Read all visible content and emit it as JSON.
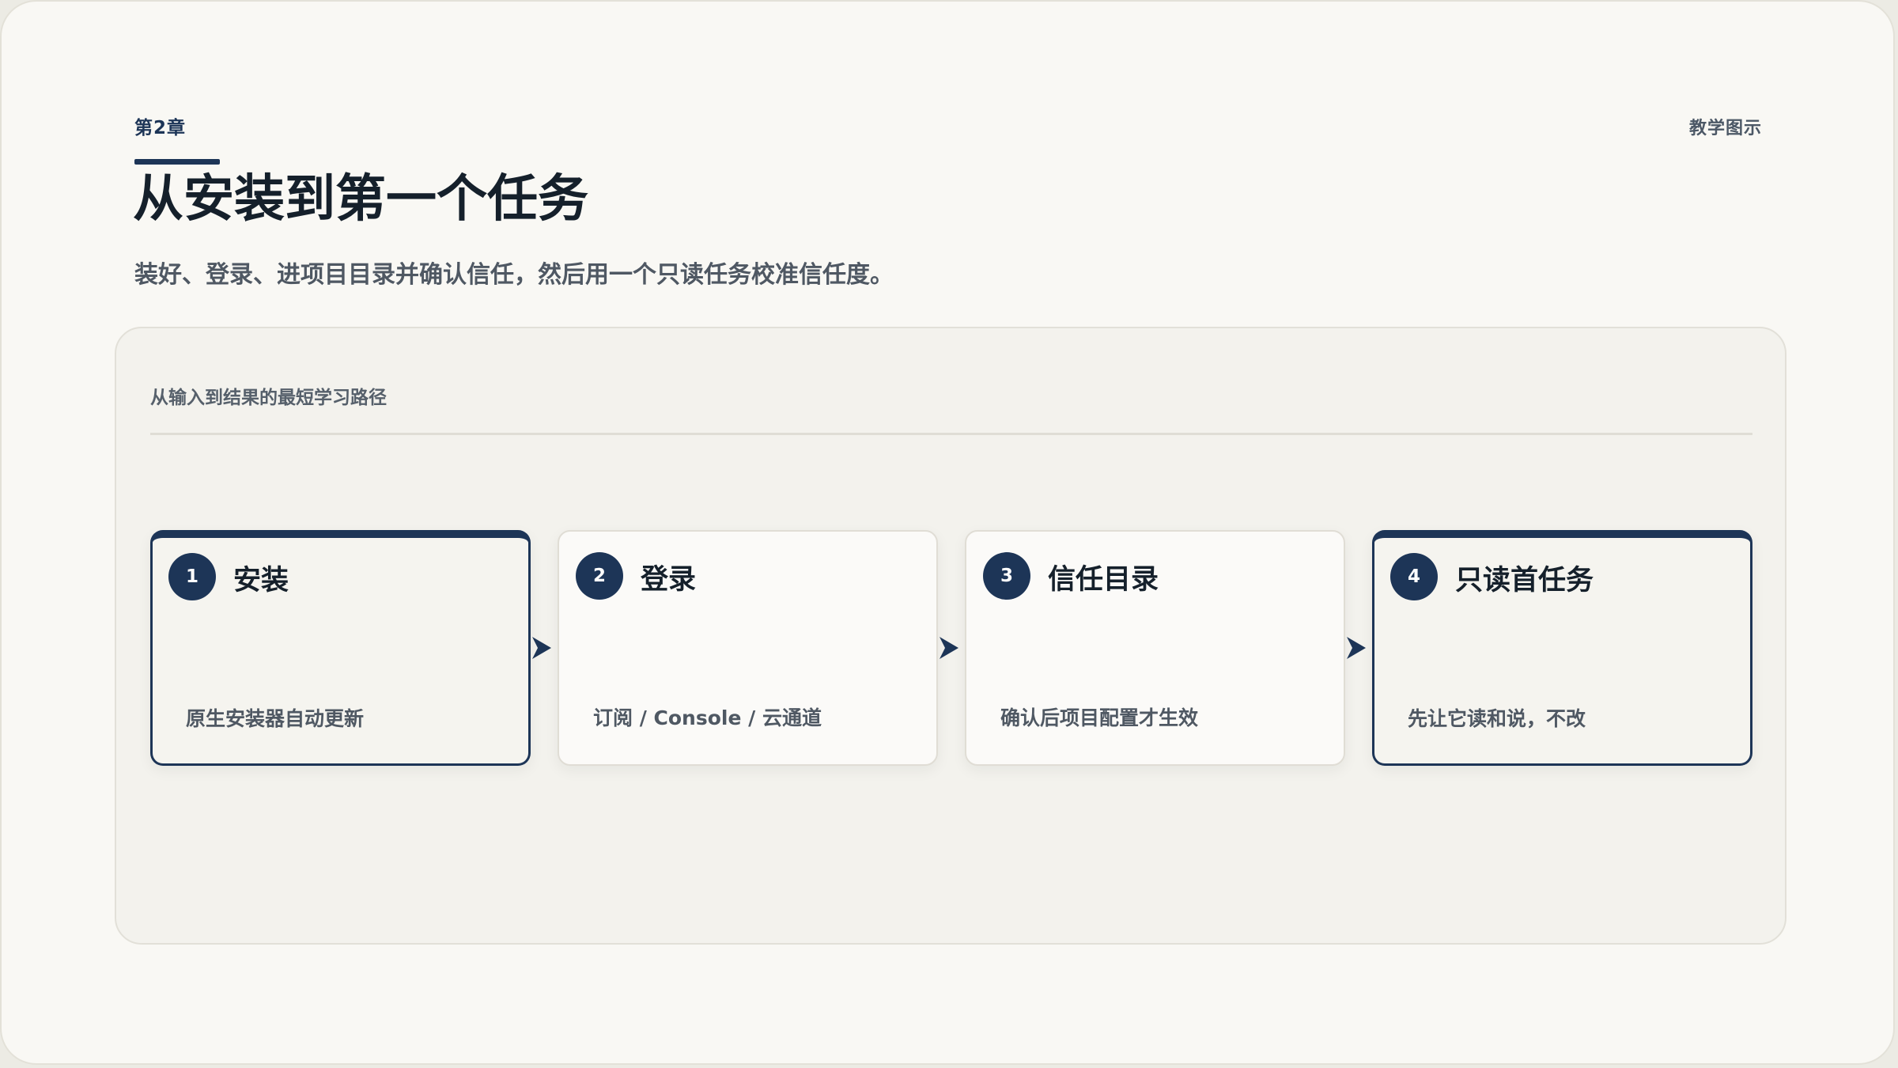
{
  "header": {
    "chapter": "第2章",
    "tag": "教学图示",
    "title": "从安装到第一个任务",
    "subtitle": "装好、登录、进项目目录并确认信任，然后用一个只读任务校准信任度。"
  },
  "panel": {
    "title": "从输入到结果的最短学习路径"
  },
  "steps": [
    {
      "number": "1",
      "title": "安装",
      "desc": "原生安装器自动更新",
      "emphasized": true
    },
    {
      "number": "2",
      "title": "登录",
      "desc": "订阅 / Console / 云通道",
      "emphasized": false
    },
    {
      "number": "3",
      "title": "信任目录",
      "desc": "确认后项目配置才生效",
      "emphasized": false
    },
    {
      "number": "4",
      "title": "只读首任务",
      "desc": "先让它读和说，不改",
      "emphasized": true
    }
  ],
  "colors": {
    "accent": "#1d3557",
    "background": "#f9f8f4",
    "panel": "#f3f2ed"
  }
}
